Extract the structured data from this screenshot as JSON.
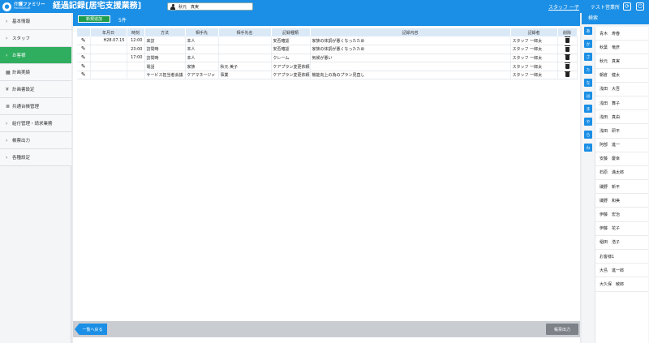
{
  "header": {
    "logo_main": "介護ファミリー",
    "logo_sub": "PanasiaSoft",
    "title": "経過記録[居宅支援業務]",
    "patient_name": "秋元　真実",
    "user_link": "スタッフ 一子",
    "office": "テスト営業所",
    "refresh_icon": "refresh-icon",
    "power_icon": "power-icon"
  },
  "sidebar": {
    "items": [
      {
        "label": "基本情報",
        "icon": "chevron-right"
      },
      {
        "label": "スタッフ",
        "icon": "chevron-right"
      },
      {
        "label": "お客様",
        "icon": "chevron-right"
      },
      {
        "label": "計画実績",
        "icon": "calendar-icon"
      },
      {
        "label": "計画書設定",
        "icon": "yen-icon"
      },
      {
        "label": "共通台帳管理",
        "icon": "database-icon"
      },
      {
        "label": "給付管理・請求業務",
        "icon": "chevron-right"
      },
      {
        "label": "帳票出力",
        "icon": "chevron-right"
      },
      {
        "label": "各種設定",
        "icon": "chevron-right"
      }
    ]
  },
  "toolbar": {
    "new_button": "新規追加",
    "count": "5件"
  },
  "table": {
    "headers": [
      "",
      "年月日",
      "時刻",
      "方法",
      "相手先",
      "相手先名",
      "記録種類",
      "記録内容",
      "記録者",
      "削除"
    ],
    "rows": [
      {
        "date": "H28.07.15",
        "time": "12:00",
        "method": "来訪",
        "party": "本人",
        "party_name": "",
        "kind": "安否確認",
        "content": "家族の体調が悪くなったため",
        "recorder": "スタッフ 一郎太"
      },
      {
        "date": "",
        "time": "23:00",
        "method": "訪問時",
        "party": "本人",
        "party_name": "",
        "kind": "安否確認",
        "content": "家族の体調が悪くなったため",
        "recorder": "スタッフ 一郎太"
      },
      {
        "date": "",
        "time": "17:00",
        "method": "訪問時",
        "party": "本人",
        "party_name": "",
        "kind": "クレーム",
        "content": "気候が悪い",
        "recorder": "スタッフ 一郎太"
      },
      {
        "date": "",
        "time": "",
        "method": "電話",
        "party": "家族",
        "party_name": "秋元 美子",
        "kind": "ケアプラン変更依頼",
        "content": "",
        "recorder": "スタッフ 一郎太"
      },
      {
        "date": "",
        "time": "",
        "method": "サービス担当者会議",
        "party": "ケアマネージャ",
        "party_name": "事業",
        "kind": "ケアプラン変更依頼",
        "content": "機能向上の為のプラン見直し",
        "recorder": "スタッフ 一郎太"
      }
    ]
  },
  "footer": {
    "back_button": "一覧へ戻る",
    "print_button": "帳票出力"
  },
  "right_panel": {
    "title": "検索",
    "kana": [
      "あ",
      "か",
      "さ",
      "た",
      "な",
      "は",
      "ま",
      "や",
      "ら",
      "わ"
    ],
    "clients": [
      "青木　寿春",
      "秋葉　竜彦",
      "秋元　真実",
      "朝倉　健太",
      "浅田　大吾",
      "浅田　舞子",
      "浅田　真由",
      "浅田　研平",
      "阿部　進一",
      "安藤　慶幸",
      "石原　満太郎",
      "磯野　新平",
      "磯野　和美",
      "伊藤　宏治",
      "伊藤　花子",
      "稲田　浩子",
      "お客様1",
      "大島　進一郎",
      "大久保　敏郎"
    ]
  }
}
